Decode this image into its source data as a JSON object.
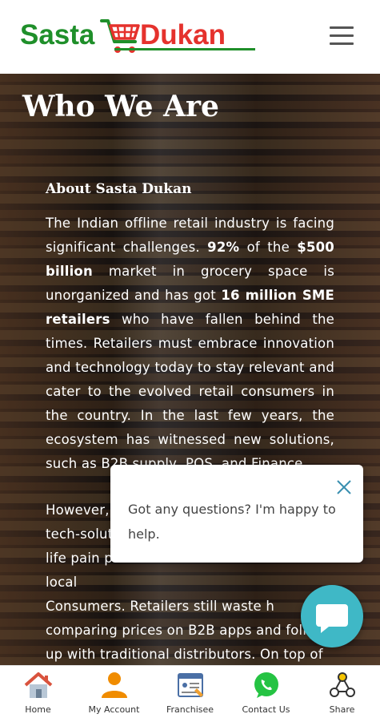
{
  "header": {
    "logo_left": "Sasta",
    "logo_right": "Dukan",
    "menu_icon": "hamburger-menu-icon"
  },
  "hero": {
    "title": "Who We Are",
    "about_heading": "About Sasta Dukan",
    "paragraph1": {
      "t1": "The Indian offline retail industry is facing significant challenges. ",
      "b1": "92%",
      "t2": " of the ",
      "b2": "$500 billion",
      "t3": " market in grocery space is unorganized and has got ",
      "b3": "16 million SME retailers",
      "t4": " who have fallen behind the times. Retailers must embrace innovation and technology today to stay relevant and cater to the evolved retail consumers in the country. In the last few years, the ecosystem has witnessed new solutions, such as B2B supply, POS, and Finance."
    },
    "paragraph2": {
      "t1": " However,",
      "t2": "tech-solut",
      "t3": "life pain p",
      "t4": "local",
      "t5": "Consumers. Retailers still waste h",
      "t6": "comparing prices on B2B apps and follo",
      "t7": "up with traditional distributors. On top of"
    }
  },
  "chat": {
    "message": "Got any questions? I'm happy to help.",
    "close_icon": "close-icon",
    "fab_icon": "chat-bubble-icon"
  },
  "bottom_nav": [
    {
      "label": "Home",
      "icon": "home-icon"
    },
    {
      "label": "My Account",
      "icon": "user-icon"
    },
    {
      "label": "Franchisee",
      "icon": "franchisee-icon"
    },
    {
      "label": "Contact Us",
      "icon": "whatsapp-icon"
    },
    {
      "label": "Share",
      "icon": "share-icon"
    }
  ],
  "colors": {
    "brand_green": "#1f8f2a",
    "brand_red": "#e5322d",
    "chat_teal": "#3fb8c6"
  }
}
